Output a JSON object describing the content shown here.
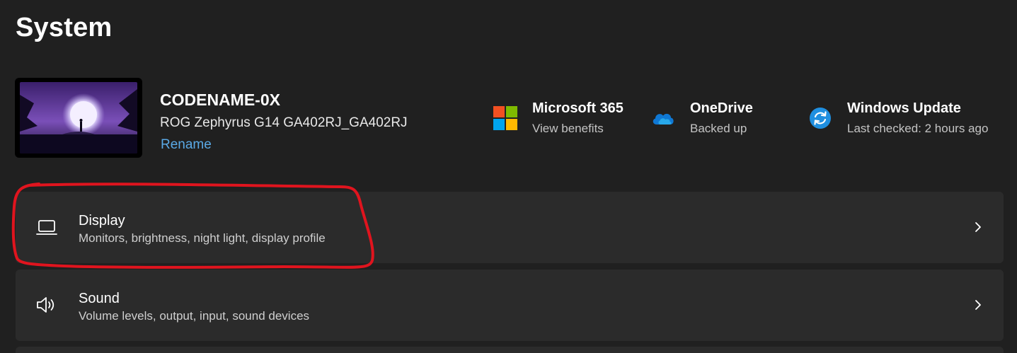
{
  "page": {
    "title": "System"
  },
  "device": {
    "name": "CODENAME-0X",
    "model": "ROG Zephyrus G14 GA402RJ_GA402RJ",
    "rename_label": "Rename",
    "thumbnail_icon": "wallpaper-thumbnail"
  },
  "status_tiles": [
    {
      "icon": "microsoft-365-icon",
      "title": "Microsoft 365",
      "subtitle": "View benefits"
    },
    {
      "icon": "onedrive-icon",
      "title": "OneDrive",
      "subtitle": "Backed up"
    },
    {
      "icon": "windows-update-icon",
      "title": "Windows Update",
      "subtitle": "Last checked: 2 hours ago"
    }
  ],
  "settings": [
    {
      "icon": "laptop-icon",
      "title": "Display",
      "description": "Monitors, brightness, night light, display profile"
    },
    {
      "icon": "speaker-icon",
      "title": "Sound",
      "description": "Volume levels, output, input, sound devices"
    }
  ],
  "colors": {
    "background": "#202020",
    "card": "#2b2b2b",
    "link": "#5aa9e6",
    "annotation": "#e0141e",
    "onedrive": "#0f78d4",
    "update": "#1f8fe0"
  }
}
